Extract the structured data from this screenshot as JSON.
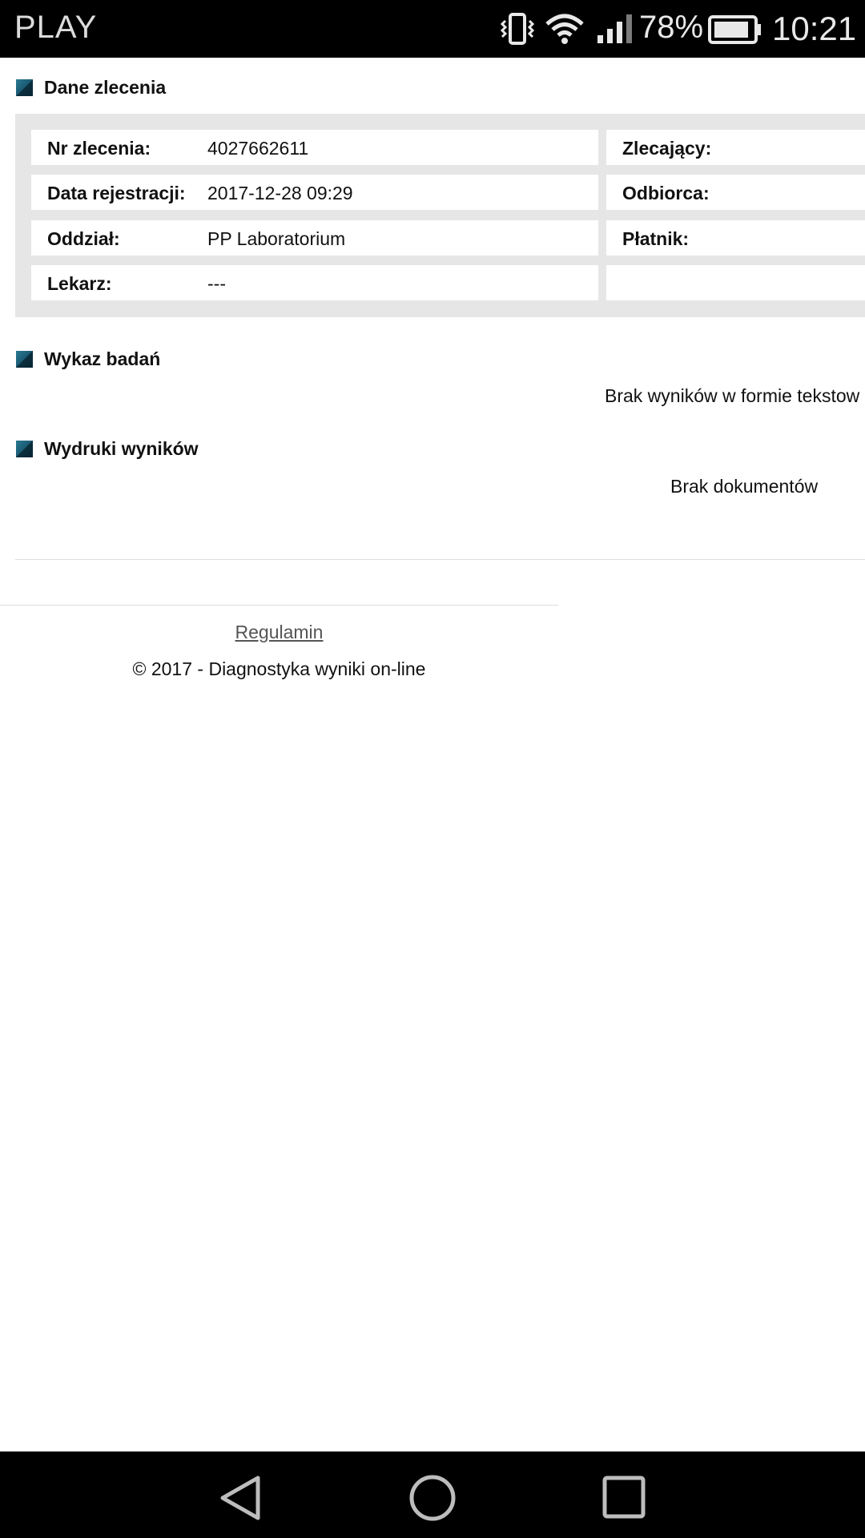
{
  "status_bar": {
    "carrier": "PLAY",
    "battery_percent": "78%",
    "time": "10:21",
    "icons": [
      "vibrate-icon",
      "wifi-icon",
      "signal-icon",
      "battery-icon"
    ]
  },
  "order_details": {
    "title": "Dane zlecenia",
    "left_rows": [
      {
        "label": "Nr zlecenia:",
        "value": "4027662611"
      },
      {
        "label": "Data rejestracji:",
        "value": "2017-12-28 09:29"
      },
      {
        "label": "Oddział:",
        "value": "PP Laboratorium"
      },
      {
        "label": "Lekarz:",
        "value": "---"
      }
    ],
    "right_rows": [
      {
        "label": "Zlecający:",
        "value": ""
      },
      {
        "label": "Odbiorca:",
        "value": ""
      },
      {
        "label": "Płatnik:",
        "value": ""
      },
      {
        "label": "",
        "value": ""
      }
    ]
  },
  "tests": {
    "title": "Wykaz badań",
    "empty_text": "Brak wyników w formie tekstow"
  },
  "printouts": {
    "title": "Wydruki wyników",
    "empty_text": "Brak dokumentów"
  },
  "footer": {
    "terms_link": "Regulamin",
    "copyright": "© 2017 - Diagnostyka wyniki on-line"
  },
  "nav_bar": {
    "buttons": [
      "back-icon",
      "home-icon",
      "recents-icon"
    ]
  },
  "colors": {
    "status_bar_bg": "#000000",
    "panel_bg": "#e6e6e6",
    "section_square": "#1a5a72"
  }
}
